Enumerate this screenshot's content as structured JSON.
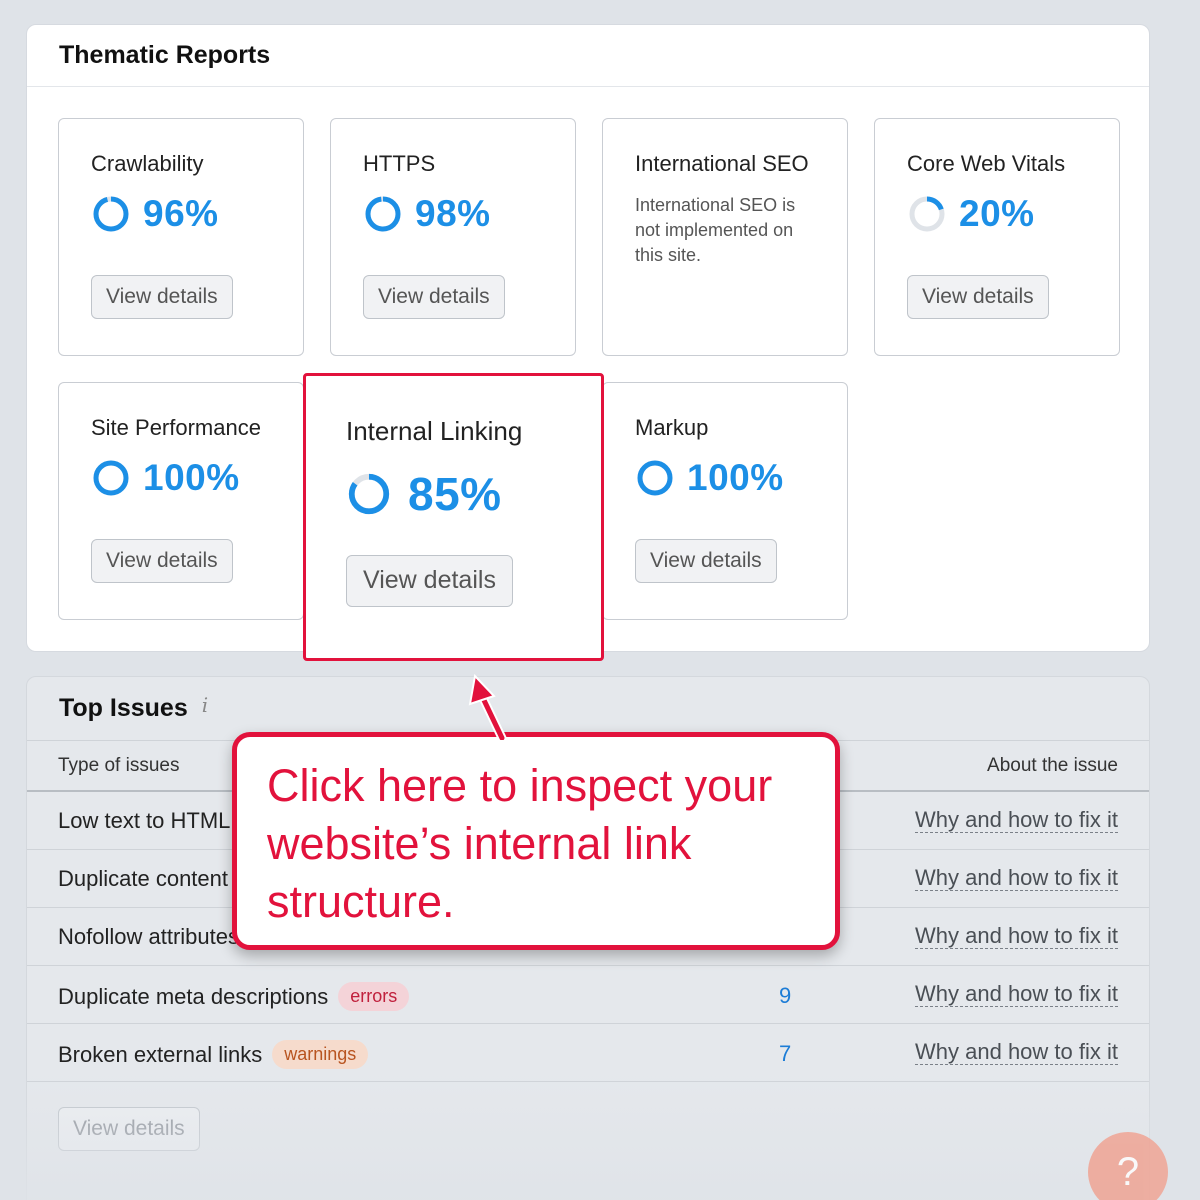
{
  "thematic": {
    "title": "Thematic Reports",
    "view_label": "View details",
    "cards": {
      "crawlability": {
        "title": "Crawlability",
        "value": "96%",
        "percent": 96
      },
      "https": {
        "title": "HTTPS",
        "value": "98%",
        "percent": 98
      },
      "international": {
        "title": "International SEO",
        "note": "International SEO is not implemented on this site."
      },
      "cwv": {
        "title": "Core Web Vitals",
        "value": "20%",
        "percent": 20
      },
      "performance": {
        "title": "Site Performance",
        "value": "100%",
        "percent": 100
      },
      "internal_linking": {
        "title": "Internal Linking",
        "value": "85%",
        "percent": 85
      },
      "markup": {
        "title": "Markup",
        "value": "100%",
        "percent": 100
      }
    }
  },
  "issues": {
    "title": "Top Issues",
    "info_icon": "i",
    "col_type": "Type of issues",
    "col_about": "About the issue",
    "link_label": "Why and how to fix it",
    "rows": [
      {
        "label": "Low text to HTML",
        "badge": "",
        "count": ""
      },
      {
        "label": "Duplicate content",
        "badge": "",
        "count": ""
      },
      {
        "label": "Nofollow attributes",
        "badge": "",
        "count": ""
      },
      {
        "label": "Duplicate meta descriptions",
        "badge": "errors",
        "count": "9"
      },
      {
        "label": "Broken external links",
        "badge": "warnings",
        "count": "7"
      }
    ],
    "view_label": "View details"
  },
  "callout": {
    "text": "Click here to inspect your website’s internal link structure."
  },
  "colors": {
    "accent": "#1c8fe6",
    "callout": "#e2123c",
    "ring_track": "#dfe3e8"
  }
}
